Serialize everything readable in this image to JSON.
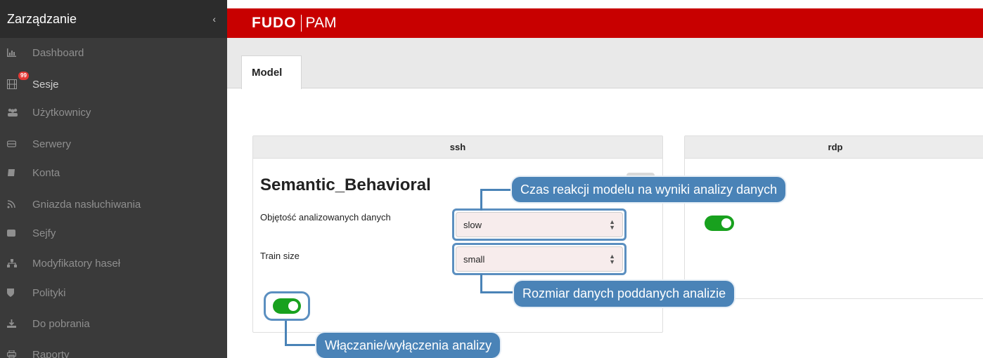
{
  "sidebar": {
    "title": "Zarządzanie",
    "collapse_glyph": "‹",
    "items": [
      {
        "label": "Dashboard",
        "icon": "bar-chart-icon"
      },
      {
        "label": "Sesje",
        "icon": "film-icon",
        "badge": "99"
      },
      {
        "label": "Użytkownicy",
        "icon": "users-icon"
      },
      {
        "label": "Serwery",
        "icon": "server-icon"
      },
      {
        "label": "Konta",
        "icon": "book-icon"
      },
      {
        "label": "Gniazda nasłuchiwania",
        "icon": "rss-icon"
      },
      {
        "label": "Sejfy",
        "icon": "safe-icon"
      },
      {
        "label": "Modyfikatory haseł",
        "icon": "sitemap-icon"
      },
      {
        "label": "Polityki",
        "icon": "shield-icon"
      },
      {
        "label": "Do pobrania",
        "icon": "download-icon"
      },
      {
        "label": "Raporty",
        "icon": "print-icon"
      }
    ]
  },
  "topbar": {
    "brand_bold": "FUDO",
    "brand_light": "PAM",
    "color": "#c80000"
  },
  "tabs": [
    {
      "label": "Model"
    }
  ],
  "panels": {
    "ssh": {
      "header": "ssh",
      "model_name": "Semantic_Behavioral",
      "fields": [
        {
          "label": "Objętość analizowanych danych",
          "value": "slow"
        },
        {
          "label": "Train size",
          "value": "small"
        }
      ],
      "enabled": true
    },
    "rdp": {
      "header": "rdp",
      "enabled": true
    }
  },
  "callouts": {
    "reaction": "Czas reakcji modelu na wyniki analizy danych",
    "size": "Rozmiar danych poddanych analizie",
    "toggle": "Włączanie/wyłączenia analizy"
  },
  "colors": {
    "accent": "#4a83b7",
    "toggle_on": "#18a11e",
    "sidebar_bg": "#3a3a3a"
  }
}
